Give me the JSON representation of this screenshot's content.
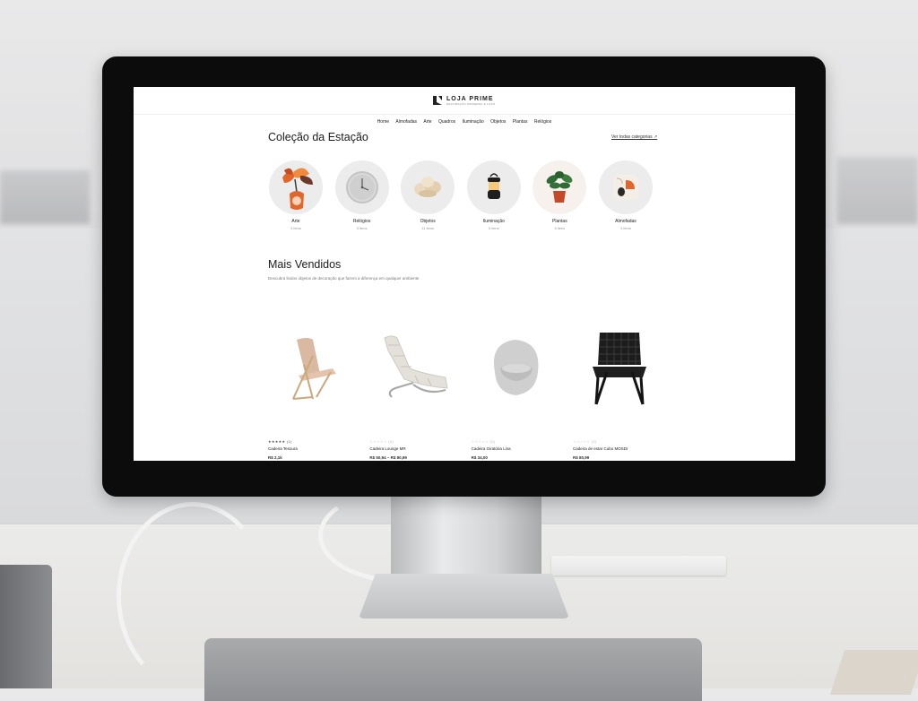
{
  "store": {
    "brand_name": "LOJA PRIME",
    "brand_tagline": "DECORAÇÃO MODERNA E LUXO"
  },
  "nav": {
    "items": [
      "Home",
      "Almofadas",
      "Arte",
      "Quadros",
      "Iluminação",
      "Objetos",
      "Plantas",
      "Relógios"
    ]
  },
  "collection": {
    "title": "Coleção da Estação",
    "see_all": "Ver todas categorias",
    "categories": [
      {
        "name": "Arte",
        "count": "3 itens",
        "icon": "flower-vase-icon"
      },
      {
        "name": "Relógios",
        "count": "5 itens",
        "icon": "wall-clock-icon"
      },
      {
        "name": "Objetos",
        "count": "11 itens",
        "icon": "knot-sculpture-icon"
      },
      {
        "name": "Iluminação",
        "count": "5 itens",
        "icon": "lantern-lamp-icon"
      },
      {
        "name": "Plantas",
        "count": "6 itens",
        "icon": "potted-plant-icon"
      },
      {
        "name": "Almofadas",
        "count": "3 itens",
        "icon": "pillow-icon"
      }
    ]
  },
  "bestsellers": {
    "title": "Mais Vendidos",
    "subtitle": "Descubra lindos objetos de decoração que fazem a diferença em qualquer ambiente",
    "products": [
      {
        "rating": "★★★★★ (1)",
        "name": "Cadeira Tesoura",
        "price": "R$ 2,1k",
        "icon": "folding-chair-icon"
      },
      {
        "rating": "☆☆☆☆☆ (0)",
        "name": "Cadeira Lounge MR",
        "price": "R$ 50,94 – R$ 80,99",
        "icon": "lounge-chair-icon"
      },
      {
        "rating": "☆☆☆☆☆ (0)",
        "name": "Cadeira Giratória Lina",
        "price": "R$ 34,00",
        "icon": "swivel-armchair-icon"
      },
      {
        "rating": "☆☆☆☆☆ (0)",
        "name": "Cadeira de estar Cubo MOSDI",
        "price": "R$ 80,99",
        "icon": "woven-chair-icon"
      }
    ]
  },
  "colors": {
    "accent_orange": "#e0662b",
    "text_dark": "#1b1b1b",
    "bezel": "#0c0c0d"
  }
}
